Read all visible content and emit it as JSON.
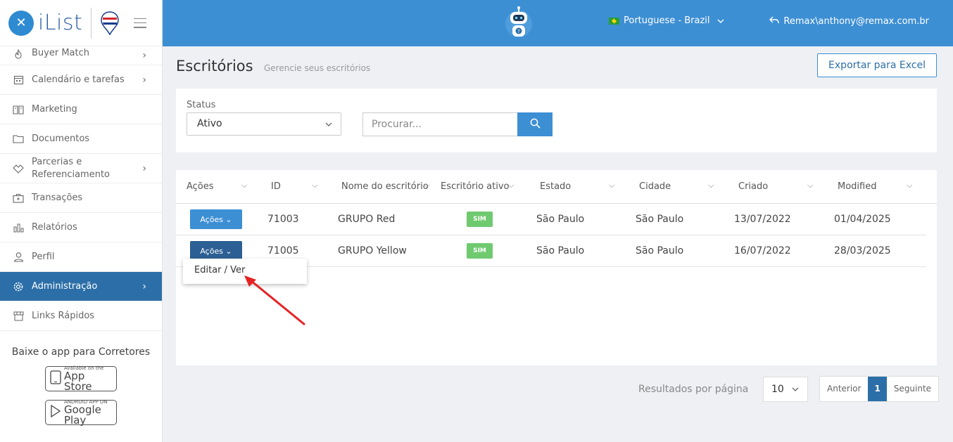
{
  "brand": {
    "name": "iList"
  },
  "sidebar": {
    "items": [
      {
        "label": "Buyer Match",
        "icon": "fire-icon",
        "chevron": true
      },
      {
        "label": "Calendário e tarefas",
        "icon": "calendar-icon",
        "chevron": true
      },
      {
        "label": "Marketing",
        "icon": "book-icon",
        "chevron": false
      },
      {
        "label": "Documentos",
        "icon": "folder-icon",
        "chevron": false
      },
      {
        "label": "Parcerias e Referenciamento",
        "icon": "handshake-icon",
        "chevron": true
      },
      {
        "label": "Transações",
        "icon": "briefcase-icon",
        "chevron": false
      },
      {
        "label": "Relatórios",
        "icon": "bar-chart-icon",
        "chevron": false
      },
      {
        "label": "Perfil",
        "icon": "user-icon",
        "chevron": false
      },
      {
        "label": "Administração",
        "icon": "gear-icon",
        "chevron": true,
        "active": true
      },
      {
        "label": "Links Rápidos",
        "icon": "store-icon",
        "chevron": false
      }
    ],
    "app_promo": "Baixe o app para Corretores",
    "appstore_small": "Available on the",
    "appstore_big": "App Store",
    "googleplay_small": "ANDROID APP ON",
    "googleplay_big": "Google Play"
  },
  "header": {
    "language": "Portuguese - Brazil",
    "user": "Remax\\anthony@remax.com.br"
  },
  "page": {
    "title": "Escritórios",
    "subtitle": "Gerencie seus escritórios",
    "export_label": "Exportar para Excel"
  },
  "filters": {
    "status_label": "Status",
    "status_value": "Ativo",
    "search_placeholder": "Procurar..."
  },
  "table": {
    "columns": [
      "Ações",
      "ID",
      "Nome do escritório",
      "Escritório ativo",
      "Estado",
      "Cidade",
      "Criado",
      "Modified"
    ],
    "rows": [
      {
        "actions": "Ações",
        "id": "71003",
        "name": "GRUPO Red",
        "active": "SIM",
        "state": "São Paulo",
        "city": "São Paulo",
        "created": "13/07/2022",
        "modified": "01/04/2025"
      },
      {
        "actions": "Ações",
        "id": "71005",
        "name": "GRUPO Yellow",
        "active": "SIM",
        "state": "São Paulo",
        "city": "São Paulo",
        "created": "16/07/2022",
        "modified": "28/03/2025"
      }
    ],
    "dropdown_item": "Editar / Ver"
  },
  "pagination": {
    "per_page_label": "Resultados por página",
    "per_page_value": "10",
    "prev": "Anterior",
    "current": "1",
    "next": "Seguinte"
  },
  "colors": {
    "header": "#3d8fd4",
    "active_nav": "#2c6fa8",
    "badge_green": "#6fca6f",
    "arrow": "#e52222"
  }
}
